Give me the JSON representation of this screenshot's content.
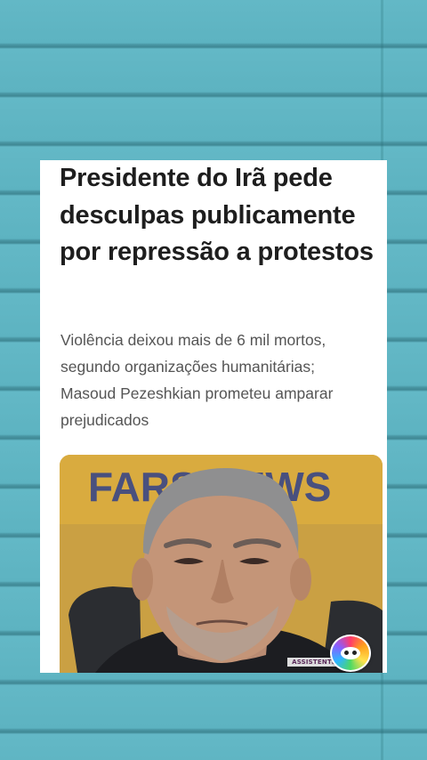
{
  "article": {
    "headline": "Presidente do Irã pede desculpas publicamente por repressão a protestos",
    "subtitle": "Violência deixou mais de 6 mil mortos, segundo organizações humanitárias; Masoud Pezeshkian prometeu amparar prejudicados",
    "photo_backdrop_text": "FARS NEWS"
  },
  "overlay": {
    "watermark_label": "ASSISTENTE",
    "badge_icon": "assistant-badge-icon"
  },
  "colors": {
    "background": "#5fb4c2",
    "card": "#ffffff",
    "headline": "#1e1e1e",
    "subtitle": "#555555",
    "photo_backdrop": "#d7a63a"
  }
}
